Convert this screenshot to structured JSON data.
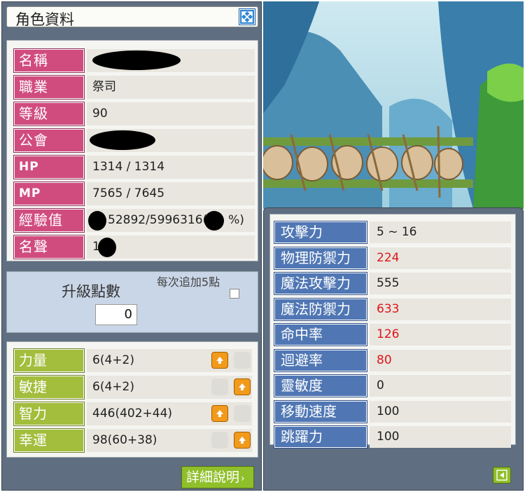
{
  "window": {
    "title": "角色資料",
    "close_icon": "maximize-toggle-icon"
  },
  "info": [
    {
      "key": "name",
      "label": "名稱",
      "value": ""
    },
    {
      "key": "job",
      "label": "職業",
      "value": "祭司"
    },
    {
      "key": "level",
      "label": "等級",
      "value": "90"
    },
    {
      "key": "guild",
      "label": "公會",
      "value": ""
    },
    {
      "key": "hp",
      "label": "HP",
      "value": "1314 / 1314"
    },
    {
      "key": "mp",
      "label": "MP",
      "value": "7565 / 7645"
    },
    {
      "key": "exp",
      "label": "經驗值",
      "value": "52892/5996316(",
      "value_suffix": "%)"
    },
    {
      "key": "fame",
      "label": "名聲",
      "value": "1"
    }
  ],
  "ability_points": {
    "label": "升級點數",
    "value": "0",
    "add5_label": "每次追加5點",
    "add5_checked": false
  },
  "stats": [
    {
      "label": "力量",
      "value": "6(4+2)"
    },
    {
      "label": "敏捷",
      "value": "6(4+2)"
    },
    {
      "label": "智力",
      "value": "446(402+44)"
    },
    {
      "label": "幸運",
      "value": "98(60+38)"
    }
  ],
  "detail_button": {
    "label": "詳細說明"
  },
  "detail_stats": [
    {
      "label": "攻擊力",
      "value": "5 ~ 16",
      "color": "#1f1f1f"
    },
    {
      "label": "物理防禦力",
      "value": "224",
      "color": "#e0161a"
    },
    {
      "label": "魔法攻擊力",
      "value": "555",
      "color": "#1f1f1f"
    },
    {
      "label": "魔法防禦力",
      "value": "633",
      "color": "#e0161a"
    },
    {
      "label": "命中率",
      "value": "126",
      "color": "#e0161a"
    },
    {
      "label": "迴避率",
      "value": "80",
      "color": "#e0161a"
    },
    {
      "label": "靈敏度",
      "value": "0",
      "color": "#1f1f1f"
    },
    {
      "label": "移動速度",
      "value": "100",
      "color": "#1f1f1f"
    },
    {
      "label": "跳躍力",
      "value": "100",
      "color": "#1f1f1f"
    }
  ],
  "back_button": {
    "icon": "arrow-left-icon"
  }
}
